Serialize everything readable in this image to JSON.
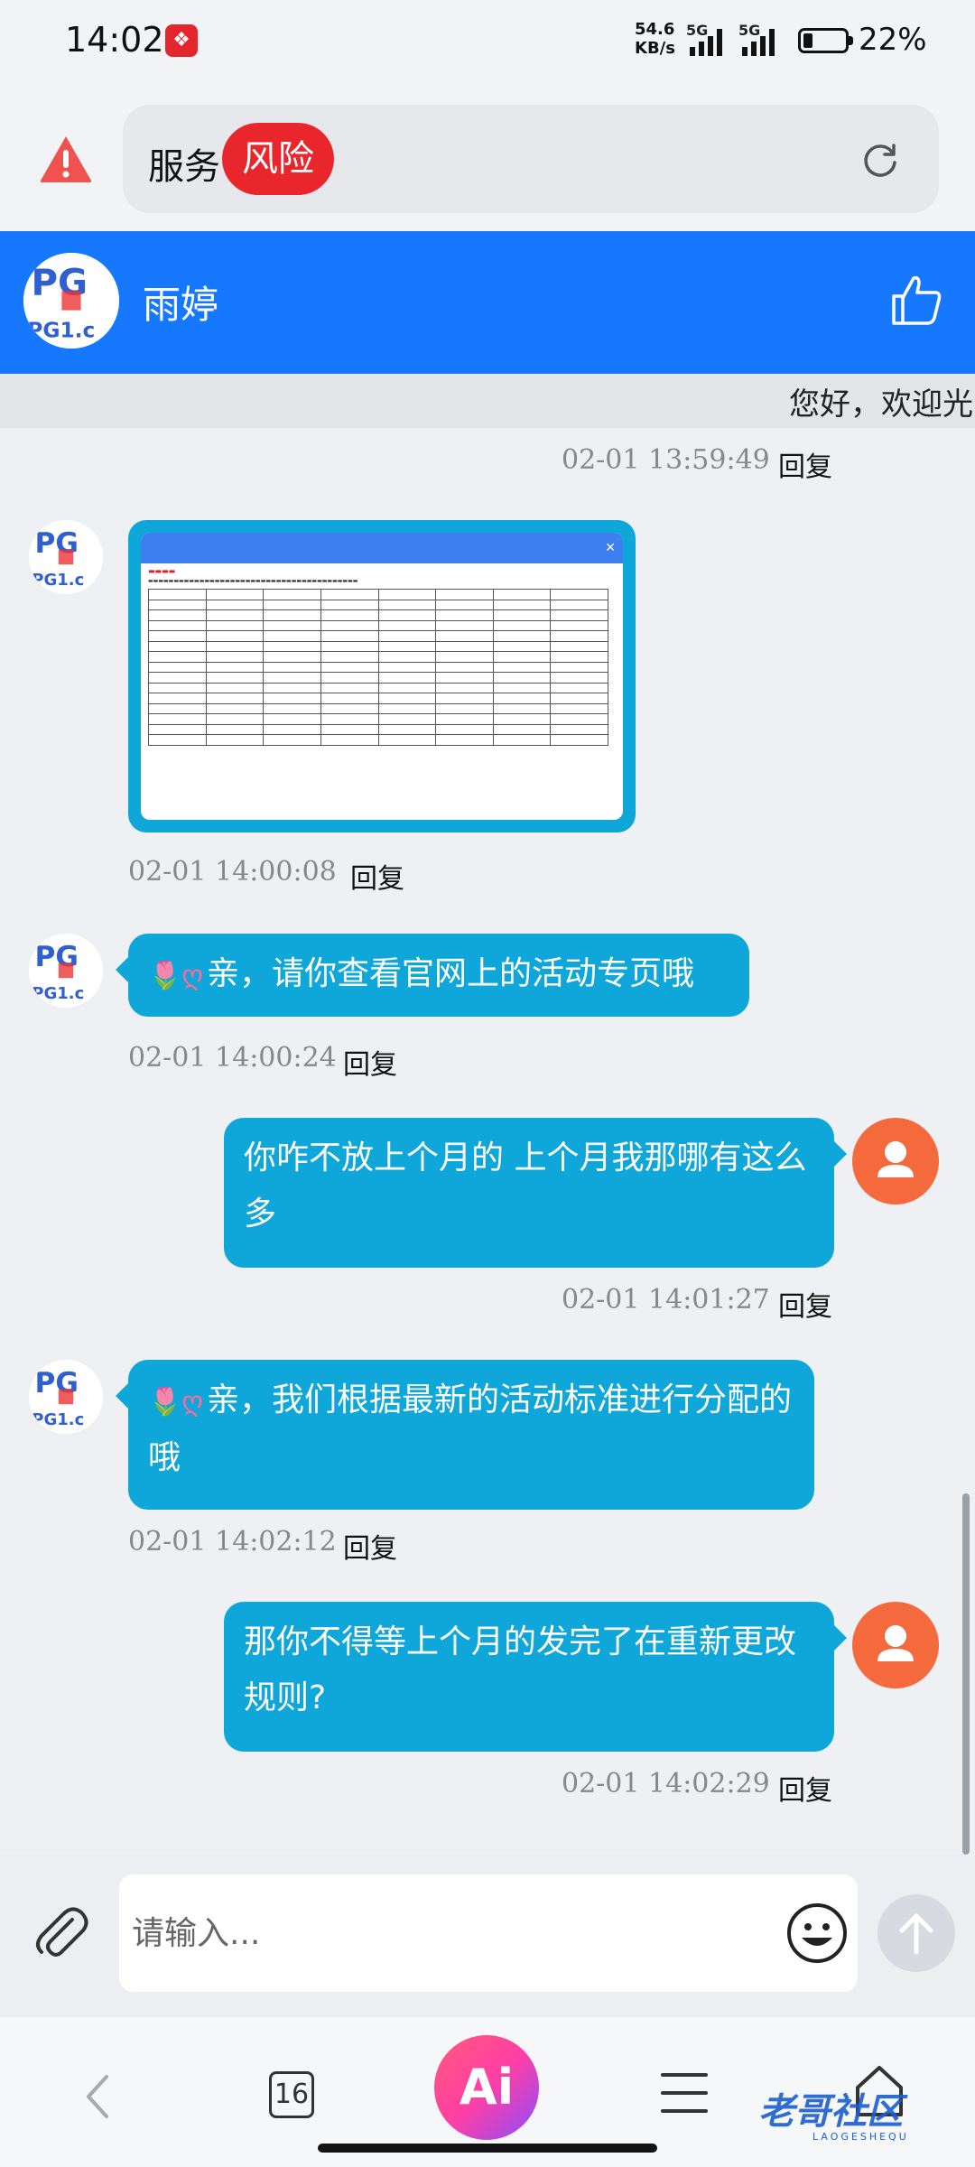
{
  "status_bar": {
    "time": "14:02",
    "speed_value": "54.6",
    "speed_unit": "KB/s",
    "net1": "5G",
    "net2": "5G",
    "battery_pct": "22%",
    "battery_level": 0.22
  },
  "address_bar": {
    "text": "服务",
    "badge": "风险"
  },
  "chat_header": {
    "agent_name": "雨婷"
  },
  "welcome_text": "您好，欢迎光",
  "reply_label": "回复",
  "messages": [
    {
      "side": "right",
      "time": "02-01 13:59:49"
    },
    {
      "side": "left",
      "type": "image",
      "time": "02-01 14:00:08"
    },
    {
      "side": "left",
      "emoji": "🌷ღ",
      "text": "亲，请你查看官网上的活动专页哦",
      "time": "02-01 14:00:24"
    },
    {
      "side": "right",
      "text": "你咋不放上个月的 上个月我那哪有这么多",
      "time": "02-01 14:01:27"
    },
    {
      "side": "left",
      "emoji": "🌷ღ",
      "text": "亲，我们根据最新的活动标准进行分配的哦",
      "time": "02-01 14:02:12"
    },
    {
      "side": "right",
      "text": "那你不得等上个月的发完了在重新更改规则?",
      "time": "02-01 14:02:29"
    }
  ],
  "input": {
    "placeholder": "请输入..."
  },
  "bottom_nav": {
    "tab_count": "16",
    "ai_label": "Ai",
    "watermark": "老哥社区",
    "watermark_sub": "LAOGESHEQU"
  },
  "colors": {
    "header_blue": "#1677ff",
    "bubble": "#0fa7d9",
    "risk_red": "#e8262c",
    "user_avatar": "#f46a3c"
  },
  "icons": [
    "warning-icon",
    "reload-icon",
    "like-icon",
    "attach-icon",
    "emoji-icon",
    "send-arrow-icon",
    "back-icon",
    "menu-icon",
    "home-icon",
    "user-icon"
  ]
}
